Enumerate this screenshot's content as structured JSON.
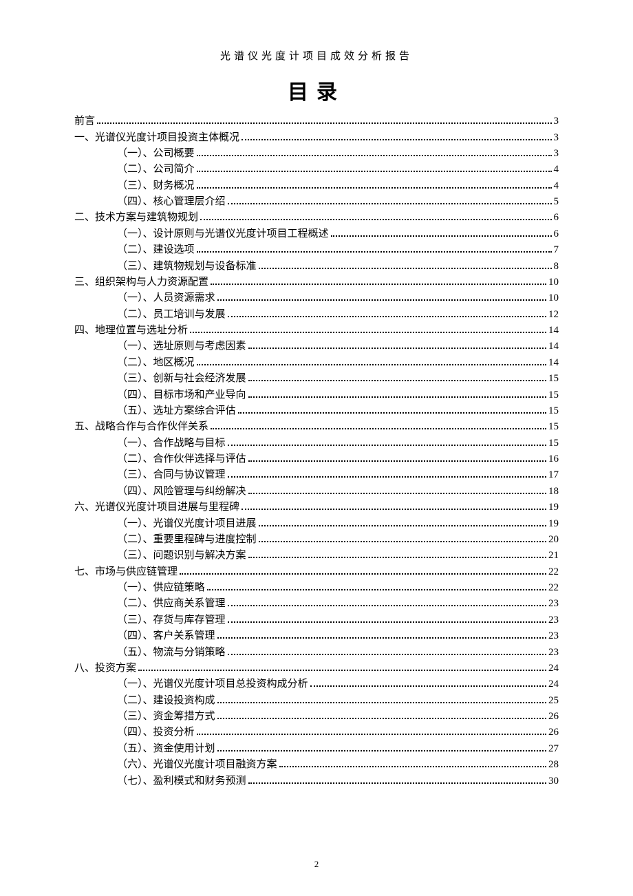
{
  "doc_header": "光谱仪光度计项目成效分析报告",
  "toc_title": "目录",
  "page_number": "2",
  "toc": [
    {
      "level": 1,
      "label": "前言",
      "page": "3"
    },
    {
      "level": 1,
      "label": "一、光谱仪光度计项目投资主体概况",
      "page": "3"
    },
    {
      "level": 2,
      "label": "（一）、公司概要",
      "page": "3"
    },
    {
      "level": 2,
      "label": "（二）、公司简介",
      "page": "4"
    },
    {
      "level": 2,
      "label": "（三）、财务概况",
      "page": "4"
    },
    {
      "level": 2,
      "label": "（四）、核心管理层介绍",
      "page": "5"
    },
    {
      "level": 1,
      "label": "二、技术方案与建筑物规划",
      "page": "6"
    },
    {
      "level": 2,
      "label": "（一）、设计原则与光谱仪光度计项目工程概述",
      "page": "6"
    },
    {
      "level": 2,
      "label": "（二）、建设选项",
      "page": "7"
    },
    {
      "level": 2,
      "label": "（三）、建筑物规划与设备标准",
      "page": "8"
    },
    {
      "level": 1,
      "label": "三、组织架构与人力资源配置",
      "page": "10"
    },
    {
      "level": 2,
      "label": "（一）、人员资源需求",
      "page": "10"
    },
    {
      "level": 2,
      "label": "（二）、员工培训与发展",
      "page": "12"
    },
    {
      "level": 1,
      "label": "四、地理位置与选址分析",
      "page": "14"
    },
    {
      "level": 2,
      "label": "（一）、选址原则与考虑因素",
      "page": "14"
    },
    {
      "level": 2,
      "label": "（二）、地区概况",
      "page": "14"
    },
    {
      "level": 2,
      "label": "（三）、创新与社会经济发展",
      "page": "15"
    },
    {
      "level": 2,
      "label": "（四）、目标市场和产业导向",
      "page": "15"
    },
    {
      "level": 2,
      "label": "（五）、选址方案综合评估",
      "page": "15"
    },
    {
      "level": 1,
      "label": "五、战略合作与合作伙伴关系",
      "page": "15"
    },
    {
      "level": 2,
      "label": "（一）、合作战略与目标",
      "page": "15"
    },
    {
      "level": 2,
      "label": "（二）、合作伙伴选择与评估",
      "page": "16"
    },
    {
      "level": 2,
      "label": "（三）、合同与协议管理",
      "page": "17"
    },
    {
      "level": 2,
      "label": "（四）、风险管理与纠纷解决",
      "page": "18"
    },
    {
      "level": 1,
      "label": "六、光谱仪光度计项目进展与里程碑",
      "page": "19"
    },
    {
      "level": 2,
      "label": "（一）、光谱仪光度计项目进展",
      "page": "19"
    },
    {
      "level": 2,
      "label": "（二）、重要里程碑与进度控制",
      "page": "20"
    },
    {
      "level": 2,
      "label": "（三）、问题识别与解决方案",
      "page": "21"
    },
    {
      "level": 1,
      "label": "七、市场与供应链管理",
      "page": "22"
    },
    {
      "level": 2,
      "label": "（一）、供应链策略",
      "page": "22"
    },
    {
      "level": 2,
      "label": "（二）、供应商关系管理",
      "page": "23"
    },
    {
      "level": 2,
      "label": "（三）、存货与库存管理",
      "page": "23"
    },
    {
      "level": 2,
      "label": "（四）、客户关系管理",
      "page": "23"
    },
    {
      "level": 2,
      "label": "（五）、物流与分销策略",
      "page": "23"
    },
    {
      "level": 1,
      "label": "八、投资方案",
      "page": "24"
    },
    {
      "level": 2,
      "label": "（一）、光谱仪光度计项目总投资构成分析",
      "page": "24"
    },
    {
      "level": 2,
      "label": "（二）、建设投资构成",
      "page": "25"
    },
    {
      "level": 2,
      "label": "（三）、资金筹措方式",
      "page": "26"
    },
    {
      "level": 2,
      "label": "（四）、投资分析",
      "page": "26"
    },
    {
      "level": 2,
      "label": "（五）、资金使用计划",
      "page": "27"
    },
    {
      "level": 2,
      "label": "（六）、光谱仪光度计项目融资方案",
      "page": "28"
    },
    {
      "level": 2,
      "label": "（七）、盈利模式和财务预测",
      "page": "30"
    }
  ]
}
